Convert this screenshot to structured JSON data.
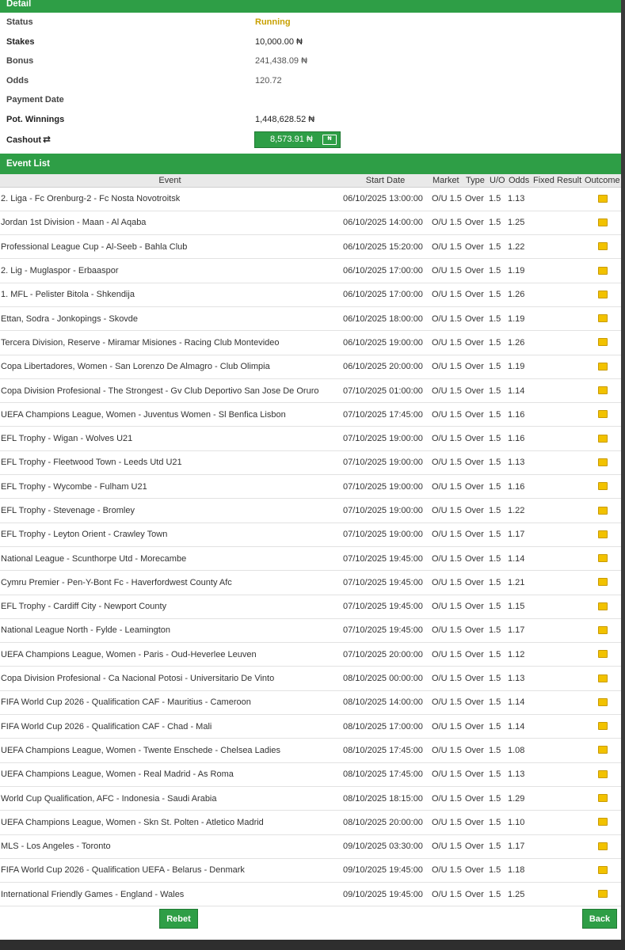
{
  "detail": {
    "title": "Detail",
    "status_label": "Status",
    "status_value": "Running",
    "stakes_label": "Stakes",
    "stakes_value": "10,000.00 ₦",
    "bonus_label": "Bonus",
    "bonus_value": "241,438.09 ₦",
    "odds_label": "Odds",
    "odds_value": "120.72",
    "payment_date_label": "Payment Date",
    "payment_date_value": "",
    "pot_winnings_label": "Pot. Winnings",
    "pot_winnings_value": "1,448,628.52 ₦",
    "cashout_label": "Cashout",
    "cashout_icon": "refresh-icon",
    "cashout_value": "8,573.91 ₦",
    "cashout_button_icon": "banknote-icon",
    "cashout_button_icon_text": "₦"
  },
  "event_list": {
    "title": "Event List",
    "columns": [
      "Event",
      "Start Date",
      "Market",
      "Type",
      "U/O",
      "Odds",
      "Fixed",
      "Result",
      "Outcome"
    ],
    "rows": [
      {
        "event": "2. Liga - Fc Orenburg-2 - Fc Nosta Novotroitsk",
        "start": "06/10/2025 13:00:00",
        "market": "O/U 1.5",
        "type": "Over",
        "uo": "1.5",
        "odds": "1.13",
        "fixed": "",
        "result": ""
      },
      {
        "event": "Jordan 1st Division - Maan - Al Aqaba",
        "start": "06/10/2025 14:00:00",
        "market": "O/U 1.5",
        "type": "Over",
        "uo": "1.5",
        "odds": "1.25",
        "fixed": "",
        "result": ""
      },
      {
        "event": "Professional League Cup - Al-Seeb - Bahla Club",
        "start": "06/10/2025 15:20:00",
        "market": "O/U 1.5",
        "type": "Over",
        "uo": "1.5",
        "odds": "1.22",
        "fixed": "",
        "result": ""
      },
      {
        "event": "2. Lig - Muglaspor - Erbaaspor",
        "start": "06/10/2025 17:00:00",
        "market": "O/U 1.5",
        "type": "Over",
        "uo": "1.5",
        "odds": "1.19",
        "fixed": "",
        "result": ""
      },
      {
        "event": "1. MFL - Pelister Bitola - Shkendija",
        "start": "06/10/2025 17:00:00",
        "market": "O/U 1.5",
        "type": "Over",
        "uo": "1.5",
        "odds": "1.26",
        "fixed": "",
        "result": ""
      },
      {
        "event": "Ettan, Sodra - Jonkopings - Skovde",
        "start": "06/10/2025 18:00:00",
        "market": "O/U 1.5",
        "type": "Over",
        "uo": "1.5",
        "odds": "1.19",
        "fixed": "",
        "result": ""
      },
      {
        "event": "Tercera Division, Reserve - Miramar Misiones - Racing Club Montevideo",
        "start": "06/10/2025 19:00:00",
        "market": "O/U 1.5",
        "type": "Over",
        "uo": "1.5",
        "odds": "1.26",
        "fixed": "",
        "result": ""
      },
      {
        "event": "Copa Libertadores, Women - San Lorenzo De Almagro - Club Olimpia",
        "start": "06/10/2025 20:00:00",
        "market": "O/U 1.5",
        "type": "Over",
        "uo": "1.5",
        "odds": "1.19",
        "fixed": "",
        "result": ""
      },
      {
        "event": "Copa Division Profesional - The Strongest - Gv Club Deportivo San Jose De Oruro",
        "start": "07/10/2025 01:00:00",
        "market": "O/U 1.5",
        "type": "Over",
        "uo": "1.5",
        "odds": "1.14",
        "fixed": "",
        "result": ""
      },
      {
        "event": "UEFA Champions League, Women - Juventus Women - Sl Benfica Lisbon",
        "start": "07/10/2025 17:45:00",
        "market": "O/U 1.5",
        "type": "Over",
        "uo": "1.5",
        "odds": "1.16",
        "fixed": "",
        "result": ""
      },
      {
        "event": "EFL Trophy - Wigan - Wolves U21",
        "start": "07/10/2025 19:00:00",
        "market": "O/U 1.5",
        "type": "Over",
        "uo": "1.5",
        "odds": "1.16",
        "fixed": "",
        "result": ""
      },
      {
        "event": "EFL Trophy - Fleetwood Town - Leeds Utd U21",
        "start": "07/10/2025 19:00:00",
        "market": "O/U 1.5",
        "type": "Over",
        "uo": "1.5",
        "odds": "1.13",
        "fixed": "",
        "result": ""
      },
      {
        "event": "EFL Trophy - Wycombe - Fulham U21",
        "start": "07/10/2025 19:00:00",
        "market": "O/U 1.5",
        "type": "Over",
        "uo": "1.5",
        "odds": "1.16",
        "fixed": "",
        "result": ""
      },
      {
        "event": "EFL Trophy - Stevenage - Bromley",
        "start": "07/10/2025 19:00:00",
        "market": "O/U 1.5",
        "type": "Over",
        "uo": "1.5",
        "odds": "1.22",
        "fixed": "",
        "result": ""
      },
      {
        "event": "EFL Trophy - Leyton Orient - Crawley Town",
        "start": "07/10/2025 19:00:00",
        "market": "O/U 1.5",
        "type": "Over",
        "uo": "1.5",
        "odds": "1.17",
        "fixed": "",
        "result": ""
      },
      {
        "event": "National League - Scunthorpe Utd - Morecambe",
        "start": "07/10/2025 19:45:00",
        "market": "O/U 1.5",
        "type": "Over",
        "uo": "1.5",
        "odds": "1.14",
        "fixed": "",
        "result": ""
      },
      {
        "event": "Cymru Premier - Pen-Y-Bont Fc - Haverfordwest County Afc",
        "start": "07/10/2025 19:45:00",
        "market": "O/U 1.5",
        "type": "Over",
        "uo": "1.5",
        "odds": "1.21",
        "fixed": "",
        "result": ""
      },
      {
        "event": "EFL Trophy - Cardiff City - Newport County",
        "start": "07/10/2025 19:45:00",
        "market": "O/U 1.5",
        "type": "Over",
        "uo": "1.5",
        "odds": "1.15",
        "fixed": "",
        "result": ""
      },
      {
        "event": "National League North - Fylde - Leamington",
        "start": "07/10/2025 19:45:00",
        "market": "O/U 1.5",
        "type": "Over",
        "uo": "1.5",
        "odds": "1.17",
        "fixed": "",
        "result": ""
      },
      {
        "event": "UEFA Champions League, Women - Paris - Oud-Heverlee Leuven",
        "start": "07/10/2025 20:00:00",
        "market": "O/U 1.5",
        "type": "Over",
        "uo": "1.5",
        "odds": "1.12",
        "fixed": "",
        "result": ""
      },
      {
        "event": "Copa Division Profesional - Ca Nacional Potosi - Universitario De Vinto",
        "start": "08/10/2025 00:00:00",
        "market": "O/U 1.5",
        "type": "Over",
        "uo": "1.5",
        "odds": "1.13",
        "fixed": "",
        "result": ""
      },
      {
        "event": "FIFA World Cup 2026 - Qualification CAF - Mauritius - Cameroon",
        "start": "08/10/2025 14:00:00",
        "market": "O/U 1.5",
        "type": "Over",
        "uo": "1.5",
        "odds": "1.14",
        "fixed": "",
        "result": ""
      },
      {
        "event": "FIFA World Cup 2026 - Qualification CAF - Chad - Mali",
        "start": "08/10/2025 17:00:00",
        "market": "O/U 1.5",
        "type": "Over",
        "uo": "1.5",
        "odds": "1.14",
        "fixed": "",
        "result": ""
      },
      {
        "event": "UEFA Champions League, Women - Twente Enschede - Chelsea Ladies",
        "start": "08/10/2025 17:45:00",
        "market": "O/U 1.5",
        "type": "Over",
        "uo": "1.5",
        "odds": "1.08",
        "fixed": "",
        "result": ""
      },
      {
        "event": "UEFA Champions League, Women - Real Madrid - As Roma",
        "start": "08/10/2025 17:45:00",
        "market": "O/U 1.5",
        "type": "Over",
        "uo": "1.5",
        "odds": "1.13",
        "fixed": "",
        "result": ""
      },
      {
        "event": "World Cup Qualification, AFC - Indonesia - Saudi Arabia",
        "start": "08/10/2025 18:15:00",
        "market": "O/U 1.5",
        "type": "Over",
        "uo": "1.5",
        "odds": "1.29",
        "fixed": "",
        "result": ""
      },
      {
        "event": "UEFA Champions League, Women - Skn St. Polten - Atletico Madrid",
        "start": "08/10/2025 20:00:00",
        "market": "O/U 1.5",
        "type": "Over",
        "uo": "1.5",
        "odds": "1.10",
        "fixed": "",
        "result": ""
      },
      {
        "event": "MLS - Los Angeles - Toronto",
        "start": "09/10/2025 03:30:00",
        "market": "O/U 1.5",
        "type": "Over",
        "uo": "1.5",
        "odds": "1.17",
        "fixed": "",
        "result": ""
      },
      {
        "event": "FIFA World Cup 2026 - Qualification UEFA - Belarus - Denmark",
        "start": "09/10/2025 19:45:00",
        "market": "O/U 1.5",
        "type": "Over",
        "uo": "1.5",
        "odds": "1.18",
        "fixed": "",
        "result": ""
      },
      {
        "event": "International Friendly Games - England - Wales",
        "start": "09/10/2025 19:45:00",
        "market": "O/U 1.5",
        "type": "Over",
        "uo": "1.5",
        "odds": "1.25",
        "fixed": "",
        "result": ""
      }
    ],
    "outcome_icon": "pending-outcome-icon"
  },
  "footer": {
    "rebet_label": "Rebet",
    "back_label": "Back"
  },
  "colors": {
    "header_green": "#2e9e46",
    "running_status": "#c8a000",
    "outcome_pending": "#f2c200"
  }
}
